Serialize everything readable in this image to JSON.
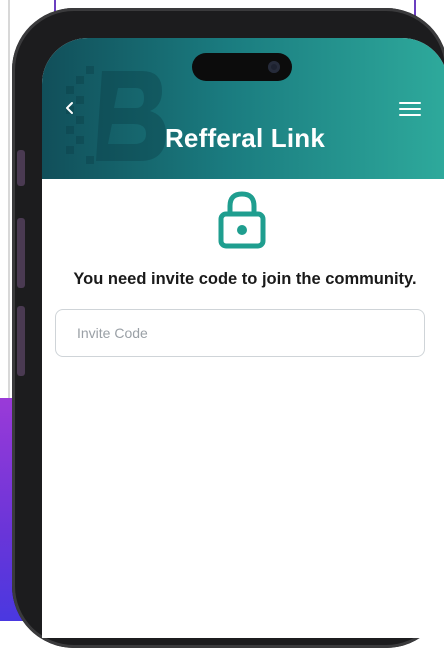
{
  "header": {
    "title": "Refferal Link",
    "back_icon": "chevron-left-icon",
    "menu_icon": "hamburger-menu-icon",
    "gradient_start": "#114f5a",
    "gradient_end": "#2eaa9c"
  },
  "content": {
    "lock_icon": "lock-icon",
    "accent_color": "#1f9e8f",
    "message": "You need invite code to join the community."
  },
  "invite_field": {
    "placeholder": "Invite Code",
    "value": ""
  }
}
